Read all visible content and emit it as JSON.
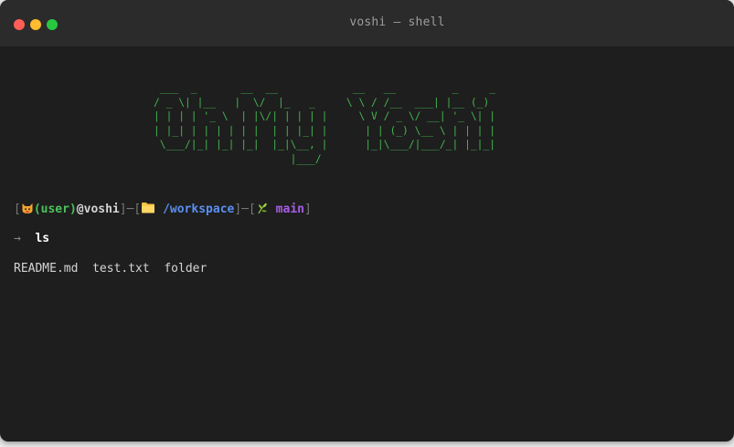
{
  "window": {
    "title": "voshi — shell"
  },
  "banner": {
    "art": " ___  _       __  __            __   __         _     _ \n/ _ \\| |__   |  \\/  |_   _     \\ \\ / /__  ___| |__ (_)\n| | | | '_ \\  | |\\/| | | | |     \\ V / _ \\/ __| '_ \\| |\n| |_| | | | | | |  | | |_| |      | | (_) \\__ \\ | | | |\n \\___/|_| |_| |_|  |_|\\__, |      |_|\\___/|___/_| |_|_|\n                      |___/                            "
  },
  "prompt": {
    "open_bracket": "[",
    "user": "(user)",
    "at_host": "@voshi",
    "separator1": "]─[",
    "path": "/workspace",
    "separator2": "]─[",
    "branch": "main",
    "close_bracket": "]"
  },
  "command": {
    "arrow": "→",
    "text": "ls"
  },
  "output": {
    "text": "README.md  test.txt  folder"
  },
  "colors": {
    "accent_green": "#43b34e",
    "user_green": "#4cc25a",
    "path_blue": "#5a8ff0",
    "branch_purple": "#a65fe6",
    "close_red": "#ff5f57",
    "minimize_yellow": "#febc2e",
    "zoom_green": "#28c840"
  },
  "icons": {
    "cat": "cat-face-icon",
    "folder": "folder-icon",
    "branch": "leaf-icon"
  }
}
